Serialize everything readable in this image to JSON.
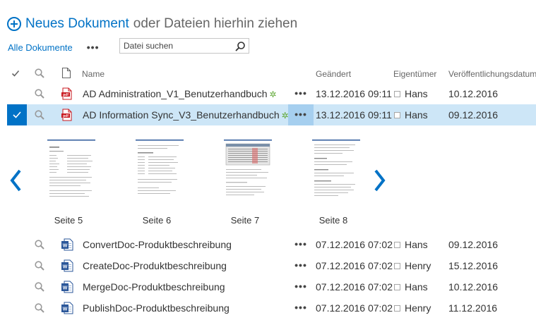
{
  "toolbar": {
    "new_document": "Neues Dokument",
    "drag_hint": "oder Dateien hierhin ziehen",
    "view_name": "Alle Dokumente",
    "more": "•••",
    "search_placeholder": "Datei suchen"
  },
  "columns": {
    "name": "Name",
    "modified": "Geändert",
    "owner": "Eigentümer",
    "published": "Veröffentlichungsdatum"
  },
  "documents": [
    {
      "name": "AD Administration_V1_Benutzerhandbuch",
      "type": "pdf",
      "new": true,
      "modified": "13.12.2016 09:11",
      "owner": "Hans",
      "published": "10.12.2016",
      "selected": false
    },
    {
      "name": "AD Information Sync_V3_Benutzerhandbuch",
      "type": "pdf",
      "new": true,
      "modified": "13.12.2016 09:11",
      "owner": "Hans",
      "published": "09.12.2016",
      "selected": true
    },
    {
      "name": "ConvertDoc-Produktbeschreibung",
      "type": "word",
      "new": false,
      "modified": "07.12.2016 07:02",
      "owner": "Hans",
      "published": "09.12.2016",
      "selected": false
    },
    {
      "name": "CreateDoc-Produktbeschreibung",
      "type": "word",
      "new": false,
      "modified": "07.12.2016 07:02",
      "owner": "Henry",
      "published": "15.12.2016",
      "selected": false
    },
    {
      "name": "MergeDoc-Produktbeschreibung",
      "type": "word",
      "new": false,
      "modified": "07.12.2016 07:02",
      "owner": "Hans",
      "published": "10.12.2016",
      "selected": false
    },
    {
      "name": "PublishDoc-Produktbeschreibung",
      "type": "word",
      "new": false,
      "modified": "07.12.2016 07:02",
      "owner": "Henry",
      "published": "11.12.2016",
      "selected": false
    }
  ],
  "preview": {
    "pages": [
      "Seite 5",
      "Seite 6",
      "Seite 7",
      "Seite 8"
    ]
  },
  "colors": {
    "accent": "#0072c6",
    "selected_row": "#cde6f7",
    "new_marker": "#5ea734",
    "pdf_icon": "#c8171e",
    "word_icon": "#2b579a"
  },
  "icons": {
    "add": "add-circle-icon",
    "search": "search-icon",
    "check": "checkmark-icon",
    "magnifier": "magnifier-icon",
    "doc_type": "document-icon",
    "pdf": "pdf-icon",
    "word": "word-icon",
    "prev": "chevron-left-icon",
    "next": "chevron-right-icon"
  }
}
